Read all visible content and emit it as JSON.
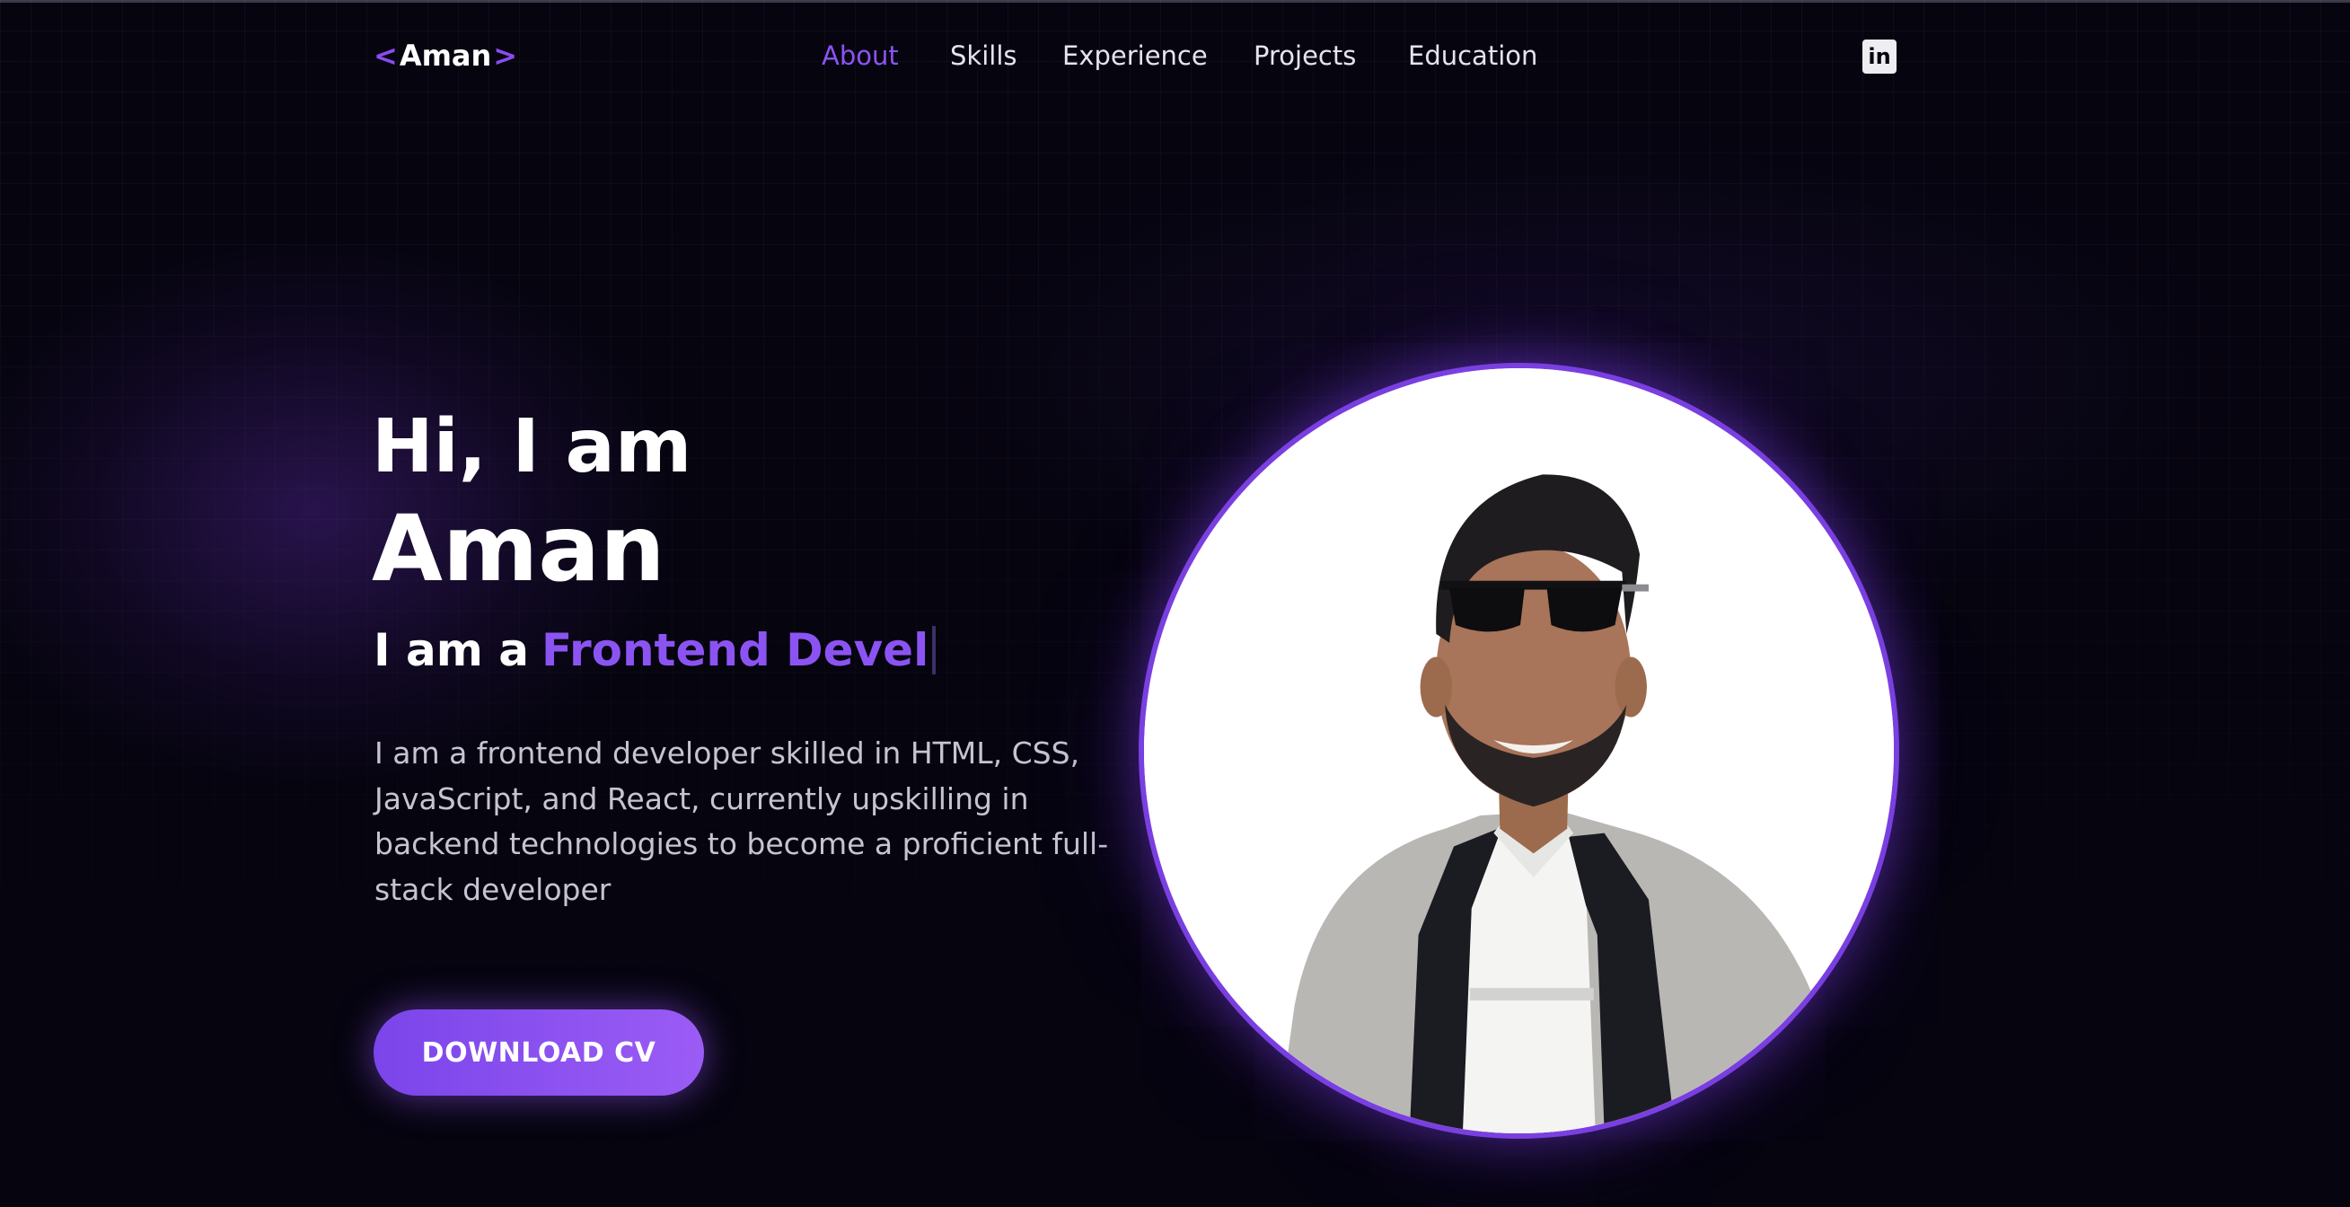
{
  "nav": {
    "logo": {
      "open": "<",
      "name": "Aman",
      "close": ">"
    },
    "links": [
      "About",
      "Skills",
      "Experience",
      "Projects",
      "Education"
    ],
    "active": "About",
    "social_icon": "linkedin-icon",
    "social_glyph": "in"
  },
  "hero": {
    "greeting": "Hi, I am",
    "name": "Aman",
    "role_prefix": "I am a",
    "role_typed": "Frontend Devel",
    "bio": "I am a frontend developer skilled in HTML, CSS, JavaScript, and React, currently upskilling in backend technologies to become a proficient full-stack developer",
    "cta_label": "DOWNLOAD CV"
  },
  "colors": {
    "background": "#06040f",
    "accent": "#8b54f2",
    "text": "#ffffff",
    "muted_text": "#c7c4d2"
  }
}
